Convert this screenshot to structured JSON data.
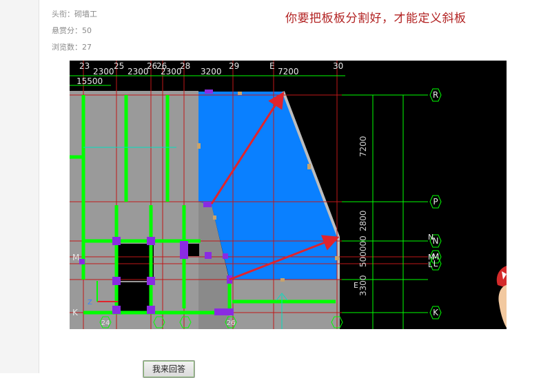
{
  "meta": {
    "title_label": "头衔：",
    "title_value": "砌墙工",
    "reward_label": "悬赏分：",
    "reward_value": "50",
    "views_label": "浏览数：",
    "views_value": "27"
  },
  "headline": "你要把板板分割好，才能定义斜板",
  "cad": {
    "top_grid": [
      "23",
      "25",
      "26",
      "26",
      "28",
      "29",
      "E",
      "30"
    ],
    "top_dims": [
      "2300",
      "2300",
      "2300",
      "3200",
      "7200"
    ],
    "total_dim": "15500",
    "right_grid": [
      "R",
      "P",
      "N",
      "M",
      "L",
      "K"
    ],
    "right_dims": [
      "7200",
      "2800",
      "500000",
      "3300"
    ],
    "left_grid": [
      "M",
      "K"
    ],
    "bottom_grid": [
      "24",
      "26"
    ],
    "inner_labels": [
      "N",
      "M",
      "L",
      "E"
    ],
    "axis_labels": [
      "Z"
    ],
    "colors": {
      "slab": "#0a80ff",
      "wall": "#00ff00",
      "column": "#8a2be2",
      "arrow": "#e0242c",
      "grid": "#c01818"
    }
  },
  "answer_button": "我来回答"
}
